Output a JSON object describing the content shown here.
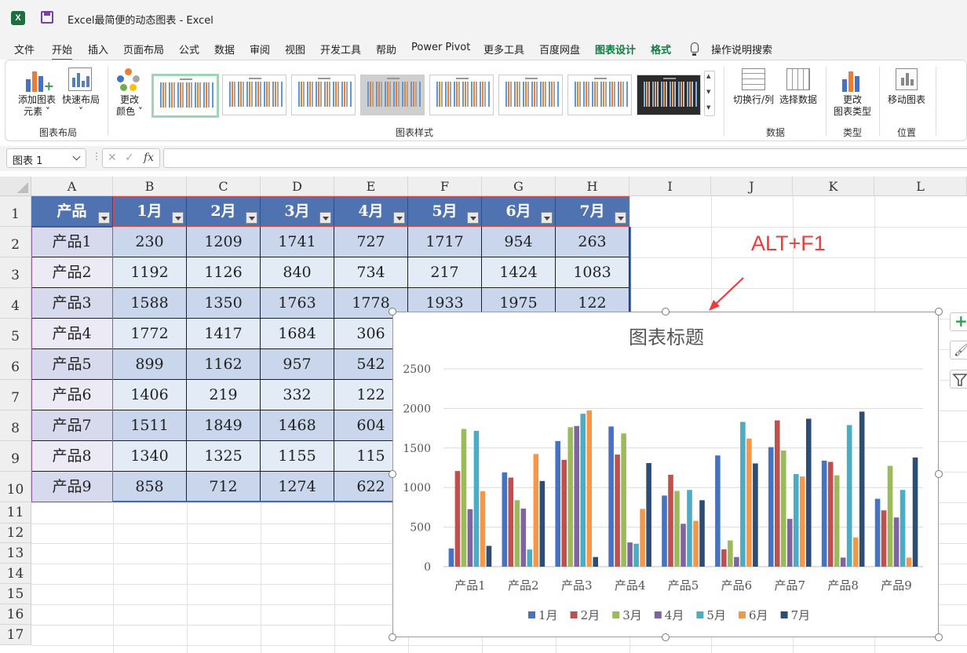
{
  "window": {
    "title": "Excel最简便的动态图表  -  Excel",
    "logo_letter": "X"
  },
  "menu": [
    {
      "label": "文件"
    },
    {
      "label": "开始"
    },
    {
      "label": "插入"
    },
    {
      "label": "页面布局"
    },
    {
      "label": "公式"
    },
    {
      "label": "数据"
    },
    {
      "label": "审阅"
    },
    {
      "label": "视图"
    },
    {
      "label": "开发工具"
    },
    {
      "label": "帮助"
    },
    {
      "label": "Power Pivot"
    },
    {
      "label": "更多工具"
    },
    {
      "label": "百度网盘"
    },
    {
      "label": "图表设计"
    },
    {
      "label": "格式"
    }
  ],
  "menu_search": "操作说明搜索",
  "ribbon": {
    "add_element": [
      "添加图表",
      "元素 ˅"
    ],
    "quick_layout": [
      "快速布局",
      "˅"
    ],
    "change_color": [
      "更改",
      "颜色 ˅"
    ],
    "switch_row_col": "切换行/列",
    "select_data": "选择数据",
    "change_type": [
      "更改",
      "图表类型"
    ],
    "move_chart": "移动图表",
    "groups": {
      "layout": "图表布局",
      "styles": "图表样式",
      "data": "数据",
      "type": "类型",
      "location": "位置"
    }
  },
  "formula_bar": {
    "name_box": "图表 1",
    "fx": "fx",
    "dots": "⋮"
  },
  "columns": [
    "A",
    "B",
    "C",
    "D",
    "E",
    "F",
    "G",
    "H",
    "I",
    "J",
    "K",
    "L"
  ],
  "rows": [
    "1",
    "2",
    "3",
    "4",
    "5",
    "6",
    "7",
    "8",
    "9",
    "10",
    "11",
    "12",
    "13",
    "14",
    "15",
    "16",
    "17"
  ],
  "table": {
    "headers": [
      "产品",
      "1月",
      "2月",
      "3月",
      "4月",
      "5月",
      "6月",
      "7月"
    ],
    "rows": [
      {
        "name": "产品1",
        "values": [
          230,
          1209,
          1741,
          727,
          1717,
          954,
          263
        ]
      },
      {
        "name": "产品2",
        "values": [
          1192,
          1126,
          840,
          734,
          217,
          1424,
          1083
        ]
      },
      {
        "name": "产品3",
        "values": [
          1588,
          1350,
          1763,
          1778,
          1933,
          1975,
          122
        ]
      },
      {
        "name": "产品4",
        "values": [
          1772,
          1417,
          1684,
          306
        ]
      },
      {
        "name": "产品5",
        "values": [
          899,
          1162,
          957,
          542
        ]
      },
      {
        "name": "产品6",
        "values": [
          1406,
          219,
          332,
          122
        ]
      },
      {
        "name": "产品7",
        "values": [
          1511,
          1849,
          1468,
          604
        ]
      },
      {
        "name": "产品8",
        "values": [
          1340,
          1325,
          1155,
          115
        ]
      },
      {
        "name": "产品9",
        "values": [
          858,
          712,
          1274,
          622
        ]
      }
    ]
  },
  "annotation": "ALT+F1",
  "colors": {
    "accent": "#107c41",
    "table_header": "#4f72b0",
    "annotation": "#ef3b3b"
  },
  "chart_data": {
    "type": "bar",
    "title": "图表标题",
    "categories": [
      "产品1",
      "产品2",
      "产品3",
      "产品4",
      "产品5",
      "产品6",
      "产品7",
      "产品8",
      "产品9"
    ],
    "series": [
      {
        "name": "1月",
        "color": "#4472c4",
        "values": [
          230,
          1192,
          1588,
          1772,
          899,
          1406,
          1511,
          1340,
          858
        ]
      },
      {
        "name": "2月",
        "color": "#c0504d",
        "values": [
          1209,
          1126,
          1350,
          1417,
          1162,
          219,
          1849,
          1325,
          712
        ]
      },
      {
        "name": "3月",
        "color": "#9bbb59",
        "values": [
          1741,
          840,
          1763,
          1684,
          957,
          332,
          1468,
          1155,
          1274
        ]
      },
      {
        "name": "4月",
        "color": "#8064a2",
        "values": [
          727,
          734,
          1778,
          306,
          542,
          122,
          604,
          115,
          622
        ]
      },
      {
        "name": "5月",
        "color": "#4bacc6",
        "values": [
          1717,
          217,
          1933,
          290,
          970,
          1830,
          1170,
          1790,
          970
        ]
      },
      {
        "name": "6月",
        "color": "#f79646",
        "values": [
          954,
          1424,
          1975,
          730,
          580,
          1620,
          1140,
          370,
          115
        ]
      },
      {
        "name": "7月",
        "color": "#2c4d75",
        "values": [
          263,
          1083,
          122,
          1310,
          840,
          1305,
          1870,
          1960,
          1380
        ]
      }
    ],
    "yticks": [
      0,
      500,
      1000,
      1500,
      2000,
      2500
    ],
    "ylim": [
      0,
      2500
    ],
    "grid": true,
    "legend": "bottom"
  }
}
